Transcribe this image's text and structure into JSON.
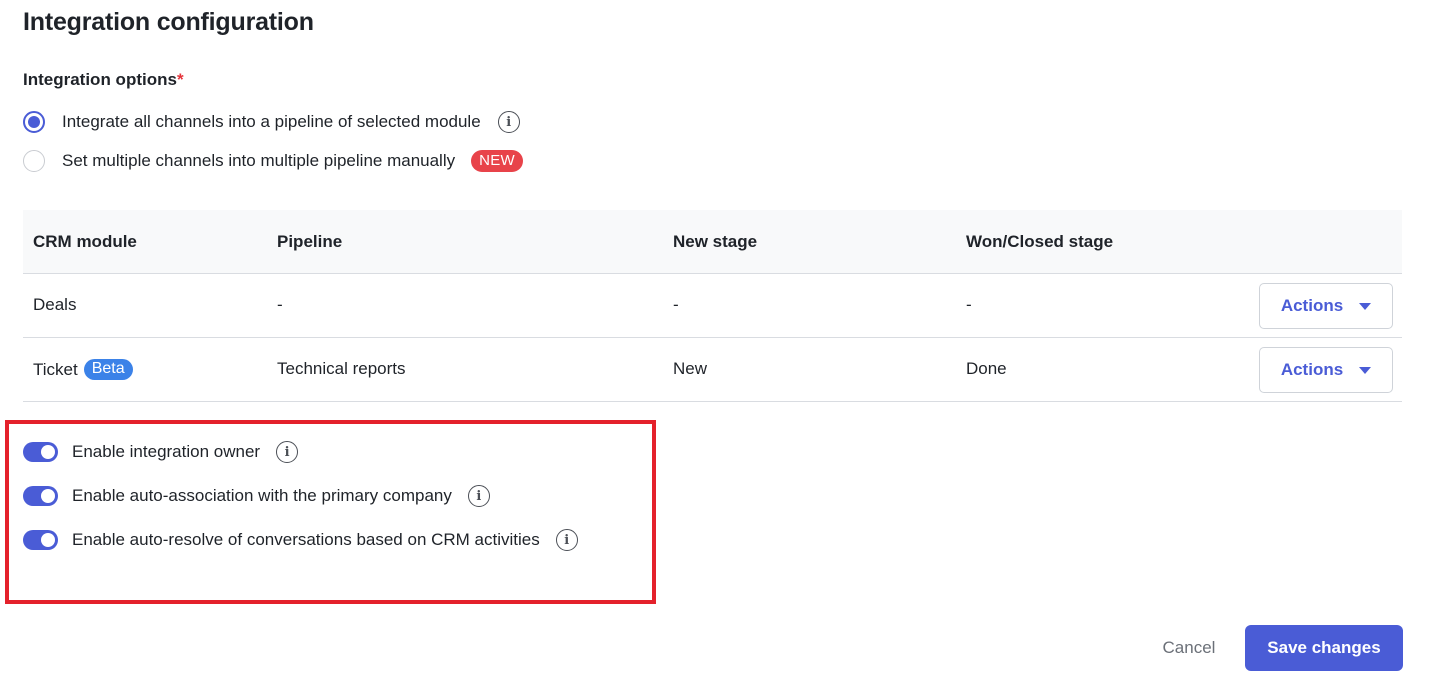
{
  "page": {
    "title": "Integration configuration"
  },
  "integration_options": {
    "label": "Integration options",
    "required_mark": "*",
    "options": [
      {
        "label": "Integrate all channels into a pipeline of selected module",
        "selected": true
      },
      {
        "label": "Set multiple channels into multiple pipeline manually",
        "selected": false,
        "badge": "NEW"
      }
    ]
  },
  "table": {
    "headers": [
      "CRM module",
      "Pipeline",
      "New stage",
      "Won/Closed stage"
    ],
    "rows": [
      {
        "module": "Deals",
        "pipeline": "-",
        "new_stage": "-",
        "won_stage": "-",
        "action": "Actions"
      },
      {
        "module": "Ticket",
        "badge": "Beta",
        "pipeline": "Technical reports",
        "new_stage": "New",
        "won_stage": "Done",
        "action": "Actions"
      }
    ]
  },
  "toggles": [
    {
      "label": "Enable integration owner",
      "enabled": true
    },
    {
      "label": "Enable auto-association with the primary company",
      "enabled": true
    },
    {
      "label": "Enable auto-resolve of conversations based on CRM activities",
      "enabled": true
    }
  ],
  "footer": {
    "cancel_label": "Cancel",
    "save_label": "Save changes"
  },
  "colors": {
    "accent": "#4a5cd6",
    "new_badge": "#e8434a",
    "beta_badge": "#3b82e8",
    "highlight": "#e4212b"
  },
  "icons": {
    "info": "info-icon",
    "caret": "caret-down-icon"
  }
}
